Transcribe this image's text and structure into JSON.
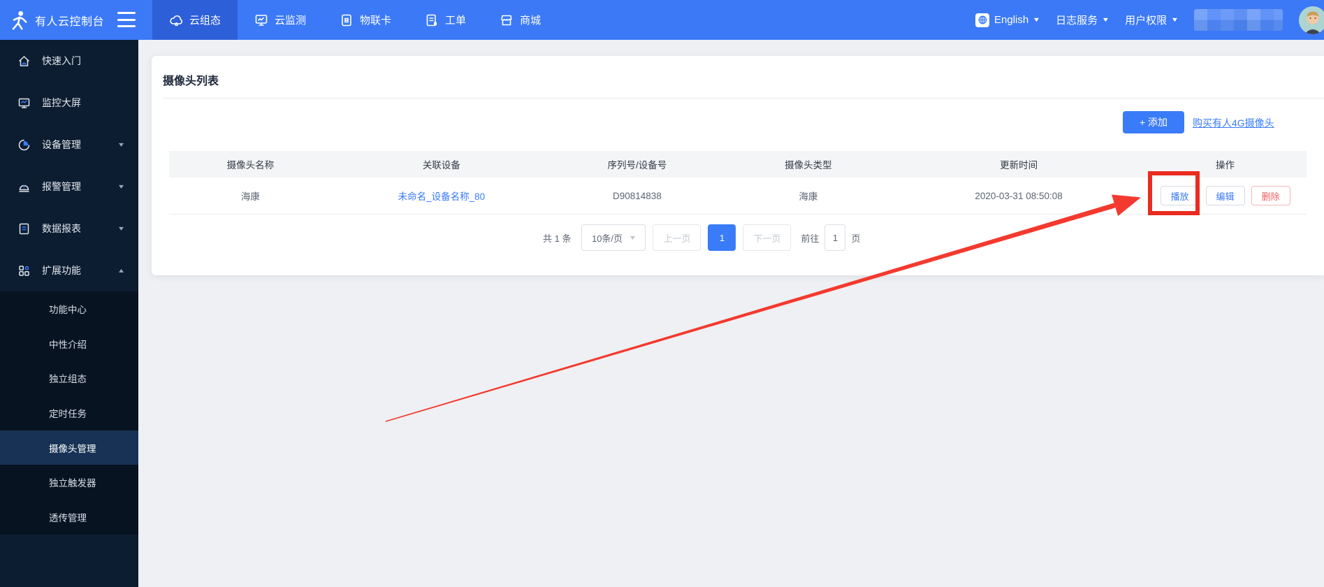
{
  "topbar": {
    "brand": "有人云控制台",
    "tabs": [
      {
        "label": "云组态",
        "active": true
      },
      {
        "label": "云监测",
        "active": false
      },
      {
        "label": "物联卡",
        "active": false
      },
      {
        "label": "工单",
        "active": false
      },
      {
        "label": "商城",
        "active": false
      }
    ],
    "language": "English",
    "log_service": "日志服务",
    "user_permission": "用户权限",
    "caret": "▼"
  },
  "sidebar": {
    "items": [
      {
        "label": "快速入门"
      },
      {
        "label": "监控大屏"
      },
      {
        "label": "设备管理",
        "caret": "▾"
      },
      {
        "label": "报警管理",
        "caret": "▾"
      },
      {
        "label": "数据报表",
        "caret": "▾"
      },
      {
        "label": "扩展功能",
        "caret": "▴"
      }
    ],
    "submenu": {
      "items": [
        {
          "label": "功能中心"
        },
        {
          "label": "中性介绍"
        },
        {
          "label": "独立组态"
        },
        {
          "label": "定时任务"
        },
        {
          "label": "摄像头管理",
          "active": true
        },
        {
          "label": "独立触发器"
        },
        {
          "label": "透传管理"
        }
      ]
    }
  },
  "main": {
    "title": "摄像头列表",
    "add_button": "+ 添加",
    "buy_link": "购买有人4G摄像头",
    "table": {
      "columns": [
        "摄像头名称",
        "关联设备",
        "序列号/设备号",
        "摄像头类型",
        "更新时间",
        "操作"
      ],
      "row": {
        "name": "海康",
        "device": "未命名_设备名称_80",
        "serial": "D90814838",
        "type": "海康",
        "updated": "2020-03-31 08:50:08",
        "actions": {
          "play": "播放",
          "edit": "编辑",
          "delete": "删除"
        }
      }
    },
    "pagination": {
      "total": "共 1 条",
      "page_size": "10条/页",
      "prev": "上一页",
      "page": "1",
      "next": "下一页",
      "goto_prefix": "前往",
      "goto_value": "1",
      "goto_suffix": "页"
    }
  },
  "colors": {
    "topbar_blue": "#3b79f7",
    "active_tab_blue": "#2c5fd8",
    "sidebar_navy": "#0d1d31",
    "accent_blue": "#3a7bf8",
    "danger_red": "#f05f5f",
    "annotation_red": "#ea2b20"
  }
}
